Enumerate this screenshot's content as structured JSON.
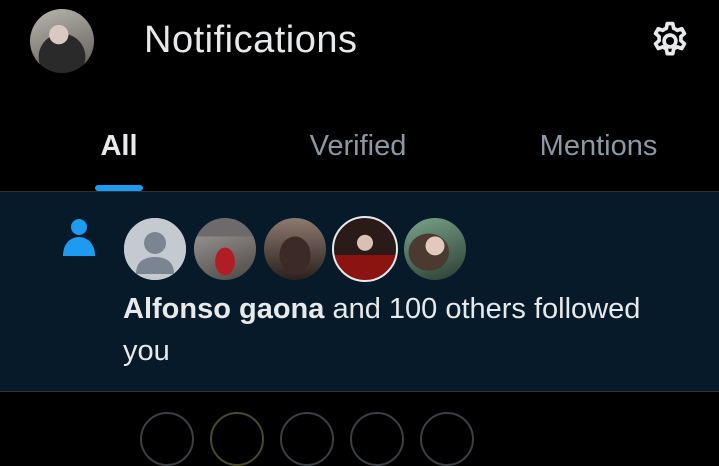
{
  "header": {
    "title": "Notifications",
    "avatar_icon": "profile-avatar",
    "settings_icon": "gear-icon"
  },
  "tabs": [
    {
      "label": "All",
      "active": true
    },
    {
      "label": "Verified",
      "active": false
    },
    {
      "label": "Mentions",
      "active": false
    }
  ],
  "notification": {
    "type_icon": "person-icon",
    "name": "Alfonso gaona",
    "rest_text": " and 100 others followed you",
    "avatar_count_shown": 5
  },
  "colors": {
    "accent": "#1d9bf0",
    "background": "#000000",
    "highlight_row": "#061a29",
    "muted_text": "#8b98a5",
    "primary_text": "#e7e9ea"
  }
}
